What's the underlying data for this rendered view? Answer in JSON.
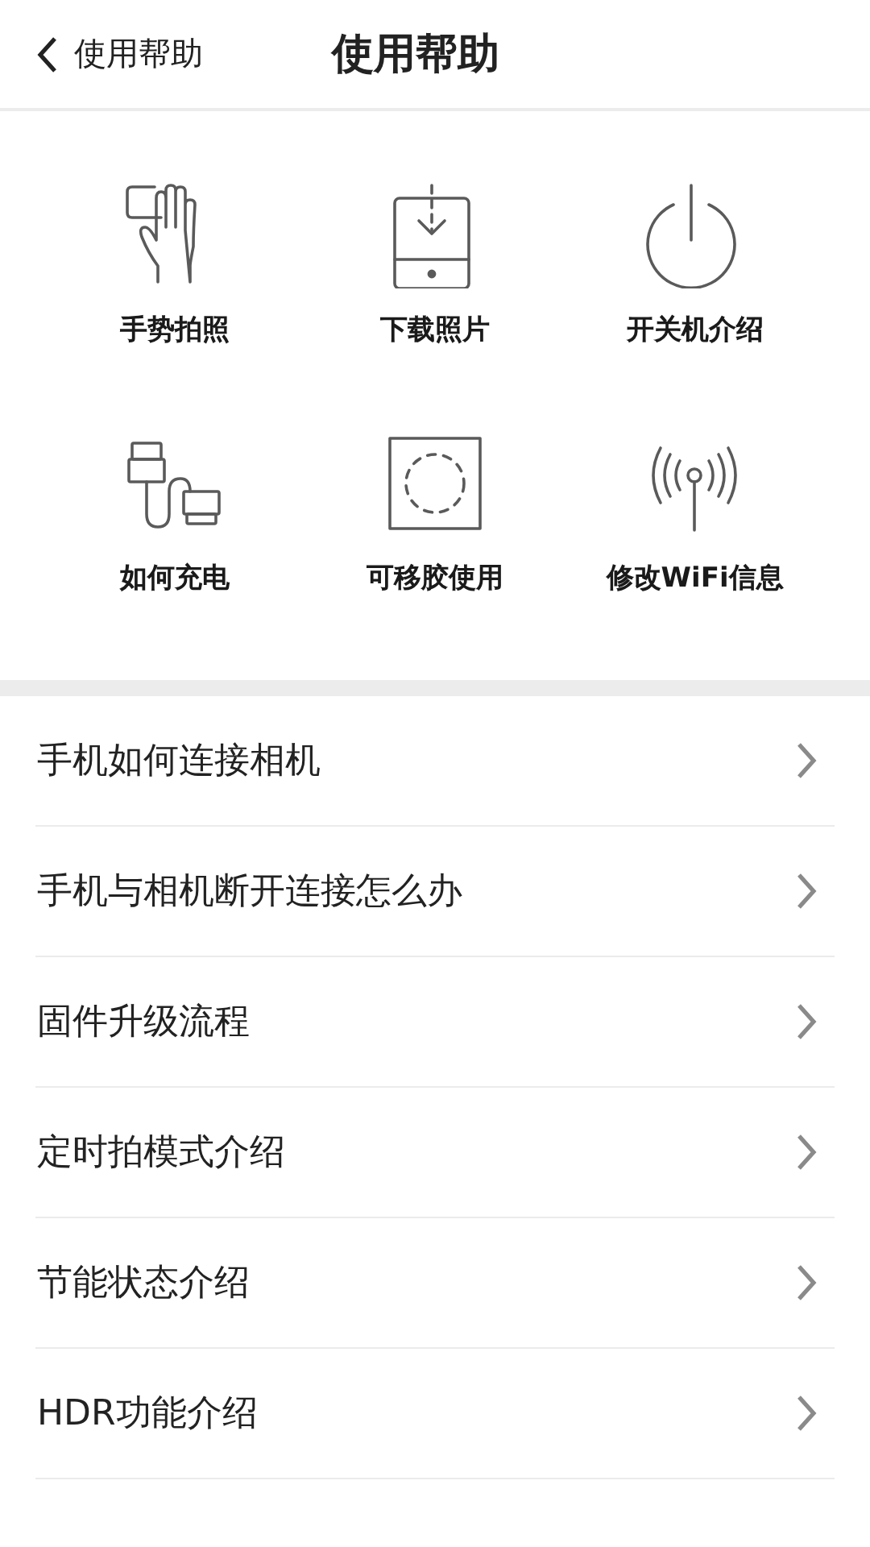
{
  "header": {
    "back_label": "使用帮助",
    "title": "使用帮助"
  },
  "shortcuts": [
    {
      "label": "手势拍照"
    },
    {
      "label": "下载照片"
    },
    {
      "label": "开关机介绍"
    },
    {
      "label": "如何充电"
    },
    {
      "label": "可移胶使用"
    },
    {
      "label": "修改WiFi信息"
    }
  ],
  "help_topics": [
    {
      "label": "手机如何连接相机"
    },
    {
      "label": "手机与相机断开连接怎么办"
    },
    {
      "label": "固件升级流程"
    },
    {
      "label": "定时拍模式介绍"
    },
    {
      "label": "节能状态介绍"
    },
    {
      "label": "HDR功能介绍"
    }
  ]
}
